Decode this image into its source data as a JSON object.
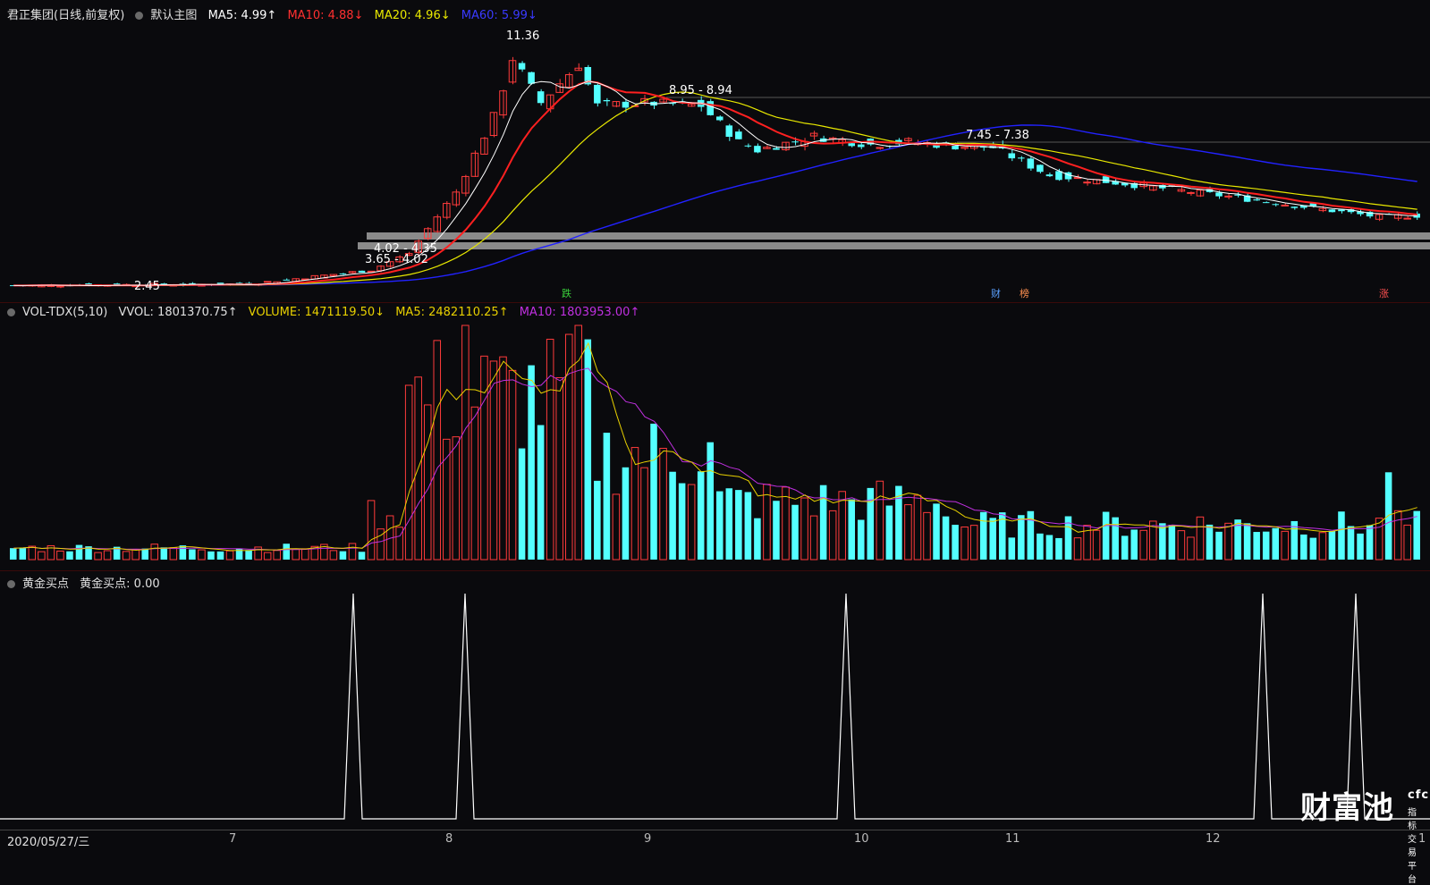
{
  "main_header": {
    "stock": "君正集团(日线,前复权)",
    "theme": "默认主图",
    "ma5": "MA5: 4.99↑",
    "ma10": "MA10: 4.88↓",
    "ma20": "MA20: 4.96↓",
    "ma60": "MA60: 5.99↓"
  },
  "vol_header": {
    "name": "VOL-TDX(5,10)",
    "vvol": "VVOL: 1801370.75↑",
    "volume": "VOLUME: 1471119.50↓",
    "ma5": "MA5: 2482110.25↑",
    "ma10": "MA10: 1803953.00↑"
  },
  "ind_header": {
    "name": "黄金买点",
    "value": "黄金买点: 0.00"
  },
  "annotations": {
    "high": "11.36",
    "low": "2.45",
    "range1": "8.95 - 8.94",
    "range2": "7.45 - 7.38",
    "range3": "4.02 - 4.35",
    "range4": "3.65 - 4.02"
  },
  "event_markers": {
    "m1": "跌",
    "m2": "财",
    "m3": "榜",
    "m4": "涨"
  },
  "xaxis": {
    "start": "2020/05/27/三",
    "months": [
      "7",
      "8",
      "9",
      "10",
      "11",
      "12",
      "1"
    ]
  },
  "watermark": {
    "brand": "财富池",
    "domain": "cfchi.com",
    "slogan": "指标交易平台"
  },
  "colors": {
    "up": "#ff3b3b",
    "down": "#54ffff",
    "ma5": "#ffffff",
    "ma10": "#ff2020",
    "ma20": "#e8e800",
    "ma60": "#2222ff",
    "vol_ma5": "#e8d000",
    "vol_ma10": "#c030e0"
  },
  "chart_data": {
    "type": "line",
    "price_range": [
      2.45,
      11.36
    ],
    "series": [
      {
        "name": "MA5",
        "values": [
          4.99
        ]
      },
      {
        "name": "MA10",
        "values": [
          4.88
        ]
      },
      {
        "name": "MA20",
        "values": [
          4.96
        ]
      },
      {
        "name": "MA60",
        "values": [
          5.99
        ]
      }
    ],
    "indicator_spikes_month_positions": [
      "7/8",
      "8",
      "10",
      "12/1",
      "1"
    ]
  }
}
